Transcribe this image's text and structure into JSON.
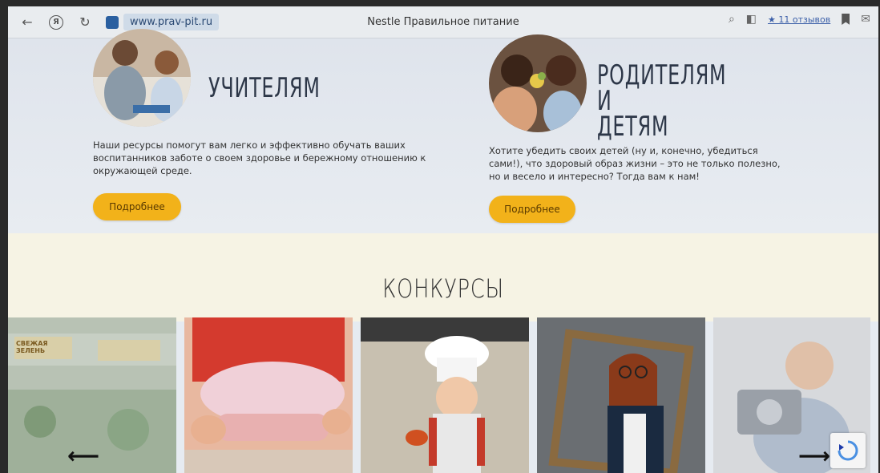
{
  "browser": {
    "url": "www.prav-pit.ru",
    "page_title": "Nestle Правильное питание",
    "reviews_label": "★ 11 отзывов",
    "icons": [
      "back-icon",
      "yandex-icon",
      "reload-icon",
      "lock-icon",
      "search-icon",
      "extension-icon",
      "bookmark-icon",
      "translate-icon"
    ]
  },
  "teachers": {
    "title": "УЧИТЕЛЯМ",
    "description": "Наши ресурсы помогут вам легко и эффективно обучать ваших воспитанников заботе о своем здоровье и бережному отношению к окружающей среде.",
    "button": "Подробнее"
  },
  "parents": {
    "title_line1": "РОДИТЕЛЯМ",
    "title_line2": "И ДЕТЯМ",
    "description": "Хотите убедить своих детей (ну и, конечно, убедиться сами!), что здоровый образ жизни – это не только полезно, но и весело и интересно? Тогда вам к нам!",
    "button": "Подробнее"
  },
  "contests": {
    "title": "КОНКУРСЫ",
    "sign_text": "СВЕЖАЯ ЗЕЛЕНЬ",
    "tiles": [
      "market-photo",
      "baking-photo",
      "chef-girl-photo",
      "frame-girl-photo",
      "boy-camera-photo"
    ]
  },
  "colors": {
    "accent": "#f2b21a",
    "hero_bg": "#e3e8ee",
    "contests_bg": "#f6f3e4"
  }
}
